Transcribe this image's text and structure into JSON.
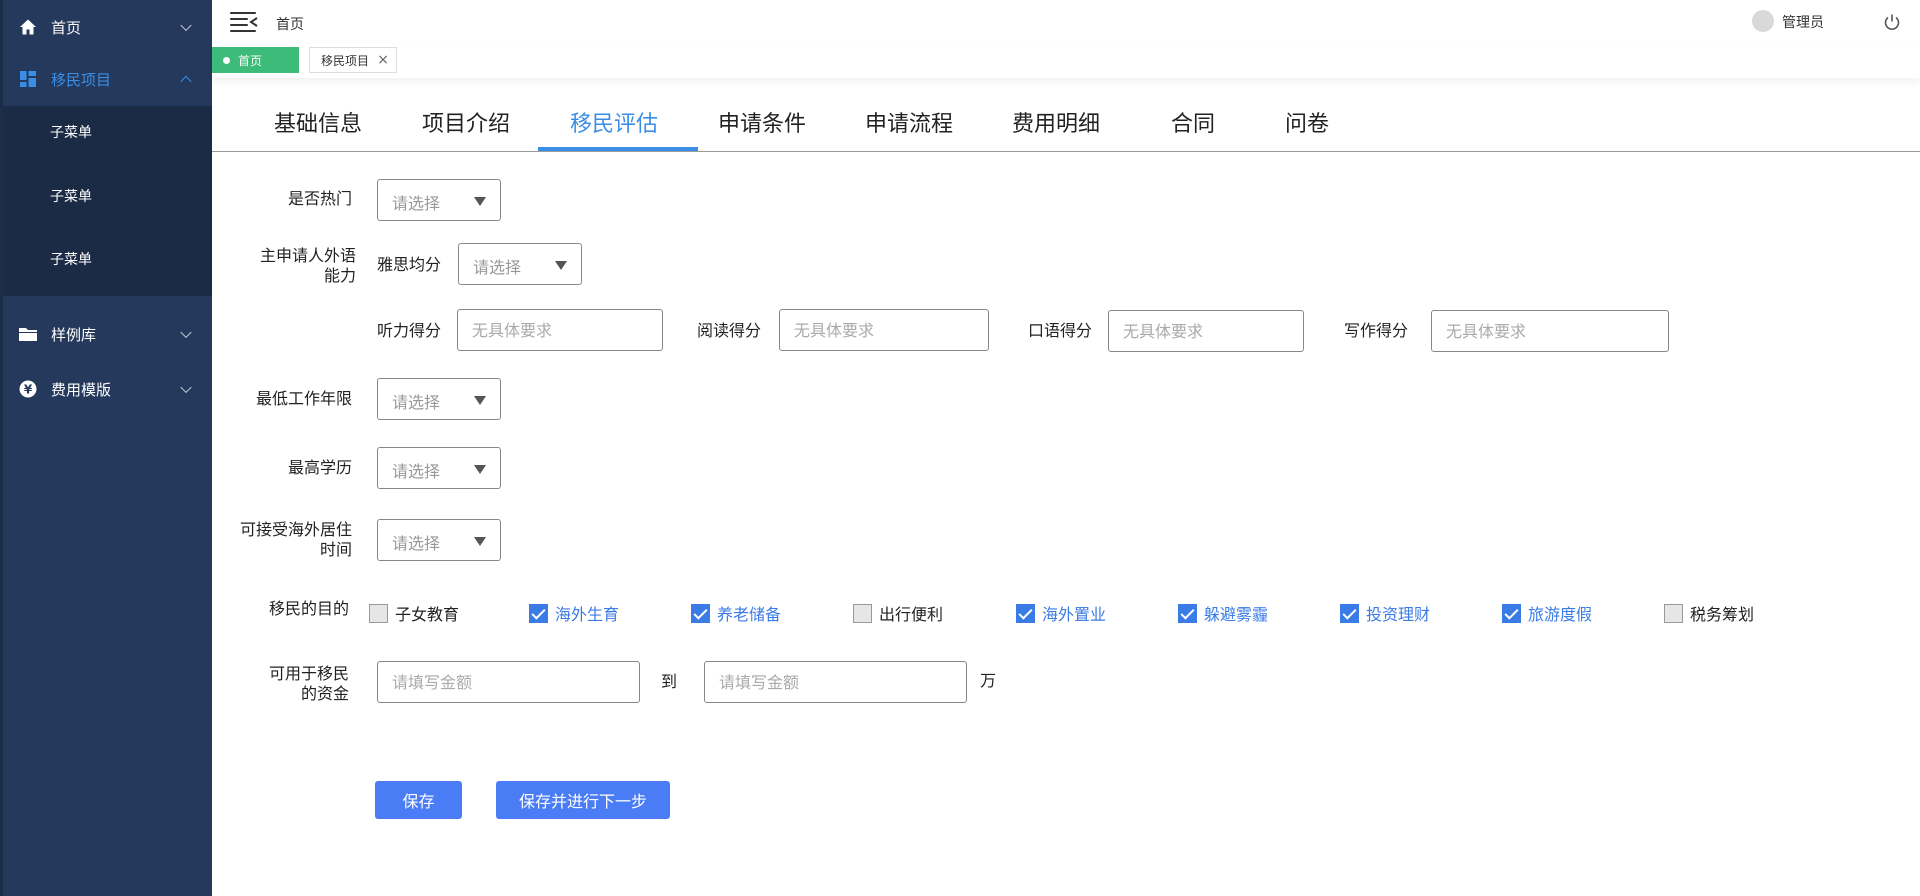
{
  "sidebar": {
    "home": "首页",
    "immigration": "移民项目",
    "submenus": [
      "子菜单",
      "子菜单",
      "子菜单"
    ],
    "cases": "样例库",
    "fee_template": "费用模版"
  },
  "topbar": {
    "breadcrumb": "首页",
    "user": "管理员"
  },
  "tabstrip": {
    "home": "首页",
    "current": "移民项目",
    "close": "×"
  },
  "section_tabs": [
    "基础信息",
    "项目介绍",
    "移民评估",
    "申请条件",
    "申请流程",
    "费用明细",
    "合同",
    "问卷"
  ],
  "active_tab": "移民评估",
  "form": {
    "hot_label": "是否热门",
    "select_placeholder": "请选择",
    "language_label_1": "主申请人外语",
    "language_label_2": "能力",
    "ielts_label": "雅思均分",
    "listening_label": "听力得分",
    "reading_label": "阅读得分",
    "speaking_label": "口语得分",
    "writing_label": "写作得分",
    "score_placeholder": "无具体要求",
    "work_years_label": "最低工作年限",
    "education_label": "最高学历",
    "abroad_label_1": "可接受海外居住",
    "abroad_label_2": "时间",
    "purpose_label": "移民的目的",
    "purposes": [
      {
        "label": "子女教育",
        "checked": false
      },
      {
        "label": "海外生育",
        "checked": true
      },
      {
        "label": "养老储备",
        "checked": true
      },
      {
        "label": "出行便利",
        "checked": false
      },
      {
        "label": "海外置业",
        "checked": true
      },
      {
        "label": "躲避雾霾",
        "checked": true
      },
      {
        "label": "投资理财",
        "checked": true
      },
      {
        "label": "旅游度假",
        "checked": true
      },
      {
        "label": "税务筹划",
        "checked": false
      }
    ],
    "funds_label_1": "可用于移民",
    "funds_label_2": "的资金",
    "amount_placeholder": "请填写金额",
    "to": "到",
    "unit": "万",
    "save": "保存",
    "save_next": "保存并进行下一步"
  },
  "colors": {
    "sidebar_bg": "#24395b",
    "accent": "#3a8ee6",
    "home_tag": "#3dbb78",
    "button": "#4a7df5"
  }
}
